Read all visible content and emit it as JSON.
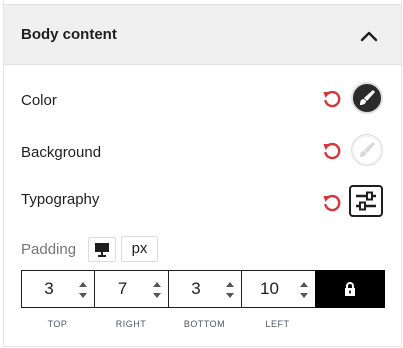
{
  "section": {
    "title": "Body content",
    "collapse_icon": "chevron-up-icon"
  },
  "rows": {
    "color": {
      "label": "Color",
      "reset_icon": "reset-icon",
      "swatch_icon": "paint-brush-icon",
      "swatch_color": "#2b2b2b"
    },
    "background": {
      "label": "Background",
      "reset_icon": "reset-icon",
      "swatch_icon": "paint-brush-icon",
      "swatch_color": "#ffffff"
    },
    "typography": {
      "label": "Typography",
      "reset_icon": "reset-icon",
      "button_icon": "sliders-icon"
    }
  },
  "padding": {
    "label": "Padding",
    "device_icon": "desktop-icon",
    "unit": "px",
    "top": {
      "value": "3",
      "caption": "TOP"
    },
    "right": {
      "value": "7",
      "caption": "RIGHT"
    },
    "bottom": {
      "value": "3",
      "caption": "BOTTOM"
    },
    "left": {
      "value": "10",
      "caption": "LEFT"
    },
    "lock_icon": "lock-icon"
  },
  "colors": {
    "reset": "#d63638",
    "text": "#1e1e1e",
    "header_bg": "#f0f0f1"
  }
}
